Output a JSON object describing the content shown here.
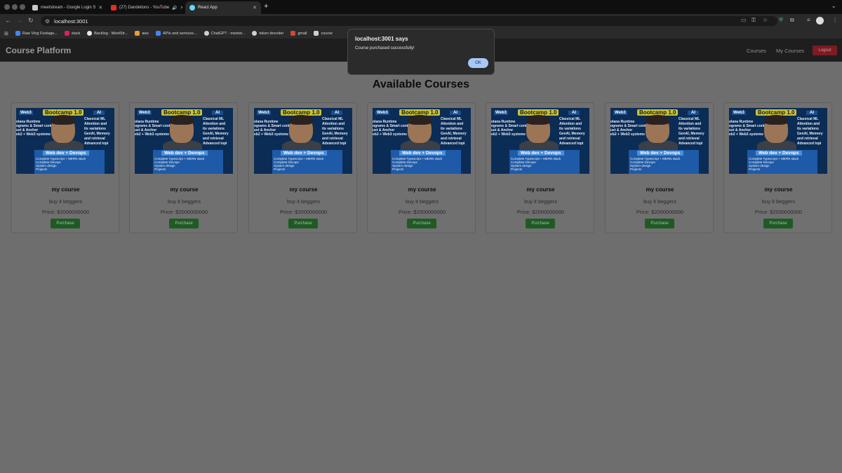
{
  "browser": {
    "tabs": [
      {
        "title": "meetstream - Google Login S",
        "icon": "google-docs-icon",
        "color": "#c8c8c8"
      },
      {
        "title": "(27) Dandelions - YouTube",
        "icon": "youtube-icon",
        "color": "#e52d27"
      },
      {
        "title": "React App",
        "icon": "react-icon",
        "color": "#61dafb"
      }
    ],
    "url": "localhost:3001",
    "bookmarks": [
      {
        "label": "Raw Vlog Footage...",
        "color": "#4285f4"
      },
      {
        "label": "slack",
        "color": "#e01e5a"
      },
      {
        "label": "Backlog - MeetStr...",
        "color": "#e8e8e8"
      },
      {
        "label": "aws",
        "color": "#f19c2a"
      },
      {
        "label": "APIs and services...",
        "color": "#4285f4"
      },
      {
        "label": "ChatGPT - meetst...",
        "color": "#d0d0d0"
      },
      {
        "label": "token decoder",
        "color": "#d0d0d0"
      },
      {
        "label": "gmail",
        "color": "#d44638"
      },
      {
        "label": "course",
        "color": "#d0d0d0"
      }
    ]
  },
  "app": {
    "brand": "Course Platform",
    "nav": {
      "courses": "Courses",
      "my_courses": "My Courses",
      "logout": "Logout"
    },
    "heading": "Available Courses",
    "thumbnail": {
      "web3": "Web3",
      "bootcamp": "Bootcamp 1.0",
      "ai": "AI",
      "left_lines": [
        "olana Runtime",
        "ograms & Smart contracts",
        "ust & Anchor",
        "eb2 + Web3 systems"
      ],
      "right_lines": [
        "Classical ML",
        "Attention and",
        "its variations",
        "GenAI, Memory",
        "and retrieval",
        "Advanced topi"
      ],
      "panel_title": "Web dev + Devops",
      "panel_lines": [
        "Complete Typescript + MERN stack",
        "Complete Devops",
        "System design",
        "Projects"
      ]
    },
    "courses": [
      {
        "title": "my course",
        "description": "buy it beggers",
        "price": "Price: $2000000000",
        "button": "Purchase"
      },
      {
        "title": "my course",
        "description": "buy it beggers",
        "price": "Price: $2000000000",
        "button": "Purchase"
      },
      {
        "title": "my course",
        "description": "buy it beggers",
        "price": "Price: $2000000000",
        "button": "Purchase"
      },
      {
        "title": "my course",
        "description": "buy it beggers",
        "price": "Price: $2000000000",
        "button": "Purchase"
      },
      {
        "title": "my course",
        "description": "buy it beggers",
        "price": "Price: $2000000000",
        "button": "Purchase"
      },
      {
        "title": "my course",
        "description": "buy it beggers",
        "price": "Price: $2000000000",
        "button": "Purchase"
      },
      {
        "title": "my course",
        "description": "buy it beggers",
        "price": "Price: $2000000000",
        "button": "Purchase"
      }
    ]
  },
  "dialog": {
    "title": "localhost:3001 says",
    "message": "Course purchased successfully!",
    "ok": "OK"
  }
}
